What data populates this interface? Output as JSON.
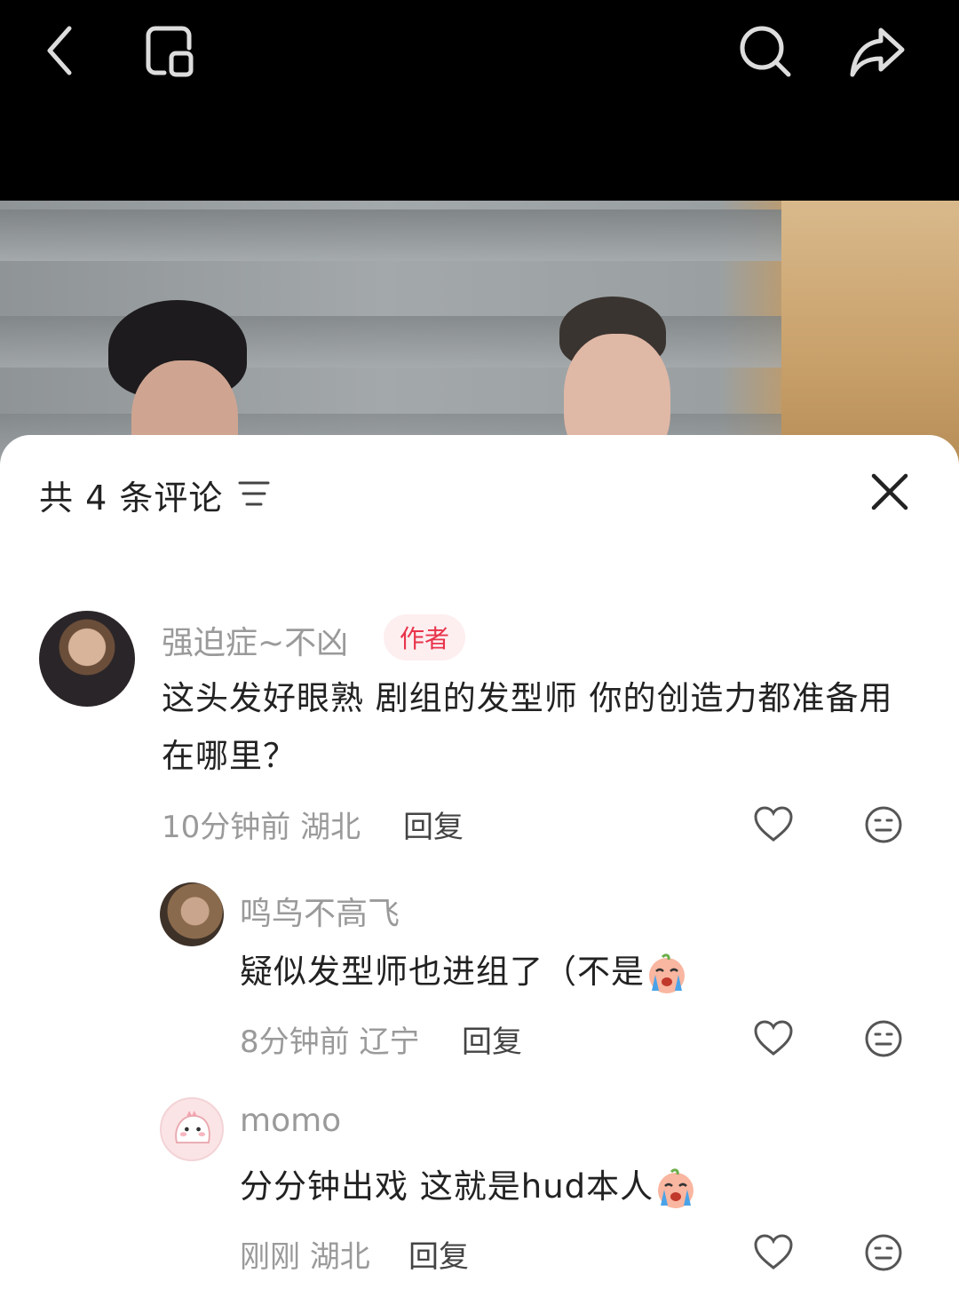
{
  "topbar": {
    "icons": [
      "back-icon",
      "minimize-window-icon",
      "search-icon",
      "share-icon"
    ]
  },
  "comments_panel": {
    "title": "共 4 条评论",
    "comments": [
      {
        "username": "强迫症~不凶",
        "badge": "作者",
        "content": "这头发好眼熟 剧组的发型师 你的创造力都准备用在哪里？",
        "time": "10分钟前",
        "location": "湖北",
        "reply_label": "回复"
      },
      {
        "username": "鸣鸟不高飞",
        "content": "疑似发型师也进组了（不是",
        "emoji": "crying-face-icon",
        "time": "8分钟前",
        "location": "辽宁",
        "reply_label": "回复"
      },
      {
        "username": "momo",
        "content": "分分钟出戏 这就是hud本人",
        "emoji": "crying-face-icon",
        "time": "刚刚",
        "location": "湖北",
        "reply_label": "回复"
      }
    ]
  }
}
